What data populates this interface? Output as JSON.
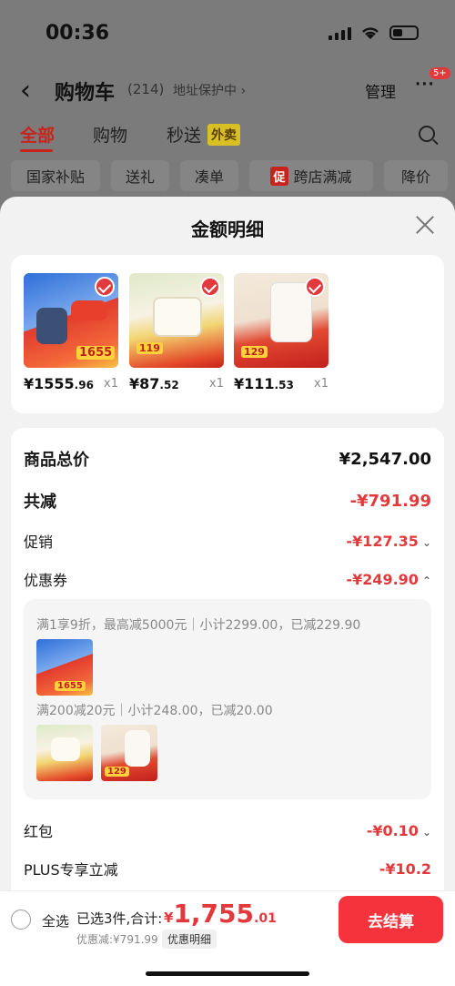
{
  "status": {
    "time": "00:36"
  },
  "header": {
    "title": "购物车",
    "count": "(214)",
    "address_protect": "地址保护中 ›",
    "manage": "管理",
    "more_badge": "5+"
  },
  "tabs": [
    {
      "label": "全部"
    },
    {
      "label": "购物"
    },
    {
      "label": "秒送"
    }
  ],
  "waimai_badge": "外卖",
  "chips": [
    {
      "label": "国家补贴"
    },
    {
      "label": "送礼"
    },
    {
      "label": "凑单"
    },
    {
      "label": "跨店满减",
      "badge": "促"
    },
    {
      "label": "降价"
    }
  ],
  "sheet": {
    "title": "金额明细",
    "products": [
      {
        "price_int": "¥1555",
        "price_dec": ".96",
        "qty": "x1",
        "art_text": "1655"
      },
      {
        "price_int": "¥87",
        "price_dec": ".52",
        "qty": "x1",
        "art_text": "119"
      },
      {
        "price_int": "¥111",
        "price_dec": ".53",
        "qty": "x1",
        "art_text": "129"
      }
    ],
    "rows": {
      "total_label": "商品总价",
      "total_value": "¥2,547.00",
      "reduce_label": "共减",
      "reduce_value": "-¥791.99",
      "promo_label": "促销",
      "promo_value": "-¥127.35",
      "coupon_label": "优惠券",
      "coupon_value": "-¥249.90",
      "redpacket_label": "红包",
      "redpacket_value": "-¥0.10",
      "plus_label": "PLUS专享立减",
      "plus_value": "-¥10.2"
    },
    "coupon_details": [
      {
        "text": "满1享9折，最高减5000元｜小计2299.00，已减229.90"
      },
      {
        "text": "满200减20元｜小计248.00，已减20.00"
      }
    ]
  },
  "bottom": {
    "select_all": "全选",
    "selected_sum": "已选3件,合计:",
    "currency": "¥",
    "total_int": "1,755",
    "total_dec": ".01",
    "discount": "优惠减:¥791.99",
    "detail": "优惠明细",
    "checkout": "去结算"
  }
}
